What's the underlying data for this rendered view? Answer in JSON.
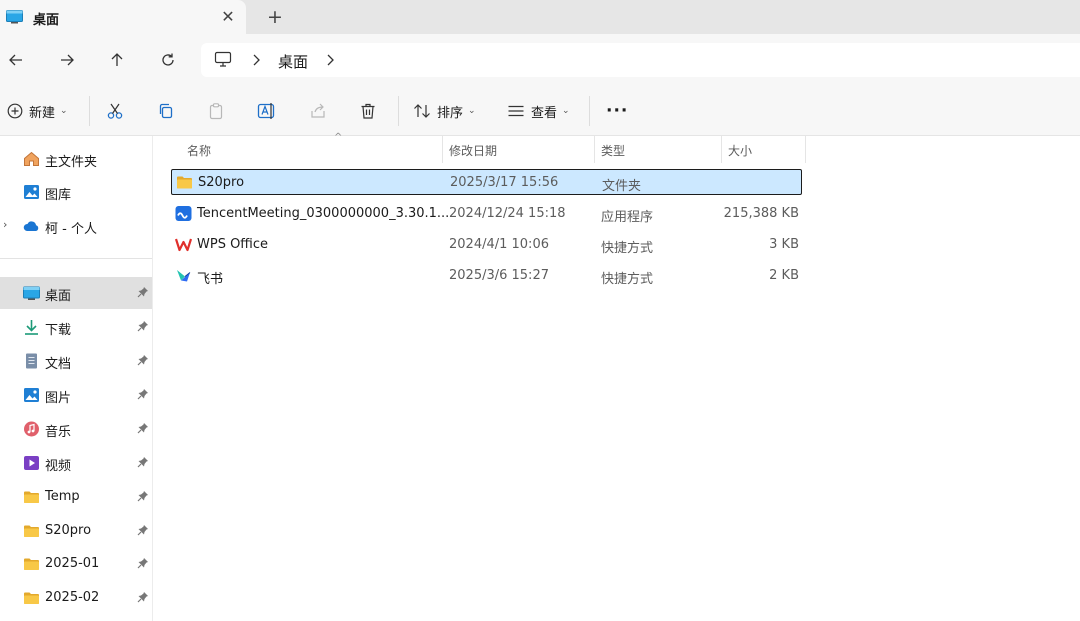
{
  "tab": {
    "title": "桌面",
    "close_symbol": "✕",
    "new_tab_symbol": "+"
  },
  "address": {
    "path_segment": "桌面"
  },
  "toolbar": {
    "new_label": "新建",
    "sort_label": "排序",
    "view_label": "查看",
    "more_label": "···",
    "caret": "⌄"
  },
  "sidebar": {
    "top_items": [
      {
        "label": "主文件夹",
        "icon": "home-icon"
      },
      {
        "label": "图库",
        "icon": "gallery-icon"
      },
      {
        "label": "柯 - 个人",
        "icon": "onedrive-icon"
      }
    ],
    "expander": "›",
    "pinned_items": [
      {
        "label": "桌面",
        "icon": "desktop-icon",
        "selected": true
      },
      {
        "label": "下载",
        "icon": "download-icon"
      },
      {
        "label": "文档",
        "icon": "document-icon"
      },
      {
        "label": "图片",
        "icon": "pictures-icon"
      },
      {
        "label": "音乐",
        "icon": "music-icon"
      },
      {
        "label": "视频",
        "icon": "video-icon"
      },
      {
        "label": "Temp",
        "icon": "folder-icon"
      },
      {
        "label": "S20pro",
        "icon": "folder-icon"
      },
      {
        "label": "2025-01",
        "icon": "folder-icon"
      },
      {
        "label": "2025-02",
        "icon": "folder-icon"
      }
    ]
  },
  "columns": {
    "name": "名称",
    "date": "修改日期",
    "type": "类型",
    "size": "大小",
    "sort_arrow": "^"
  },
  "files": [
    {
      "name": "S20pro",
      "date": "2025/3/17 15:56",
      "type": "文件夹",
      "size": "",
      "icon": "folder-icon",
      "selected": true
    },
    {
      "name": "TencentMeeting_0300000000_3.30.1...",
      "date": "2024/12/24 15:18",
      "type": "应用程序",
      "size": "215,388 KB",
      "icon": "tencent-meeting-icon"
    },
    {
      "name": "WPS Office",
      "date": "2024/4/1 10:06",
      "type": "快捷方式",
      "size": "3 KB",
      "icon": "wps-icon"
    },
    {
      "name": "飞书",
      "date": "2025/3/6 15:27",
      "type": "快捷方式",
      "size": "2 KB",
      "icon": "feishu-icon"
    }
  ],
  "colors": {
    "folder": "#f8c847",
    "selection": "#cce8ff",
    "accent": "#0067c0"
  }
}
